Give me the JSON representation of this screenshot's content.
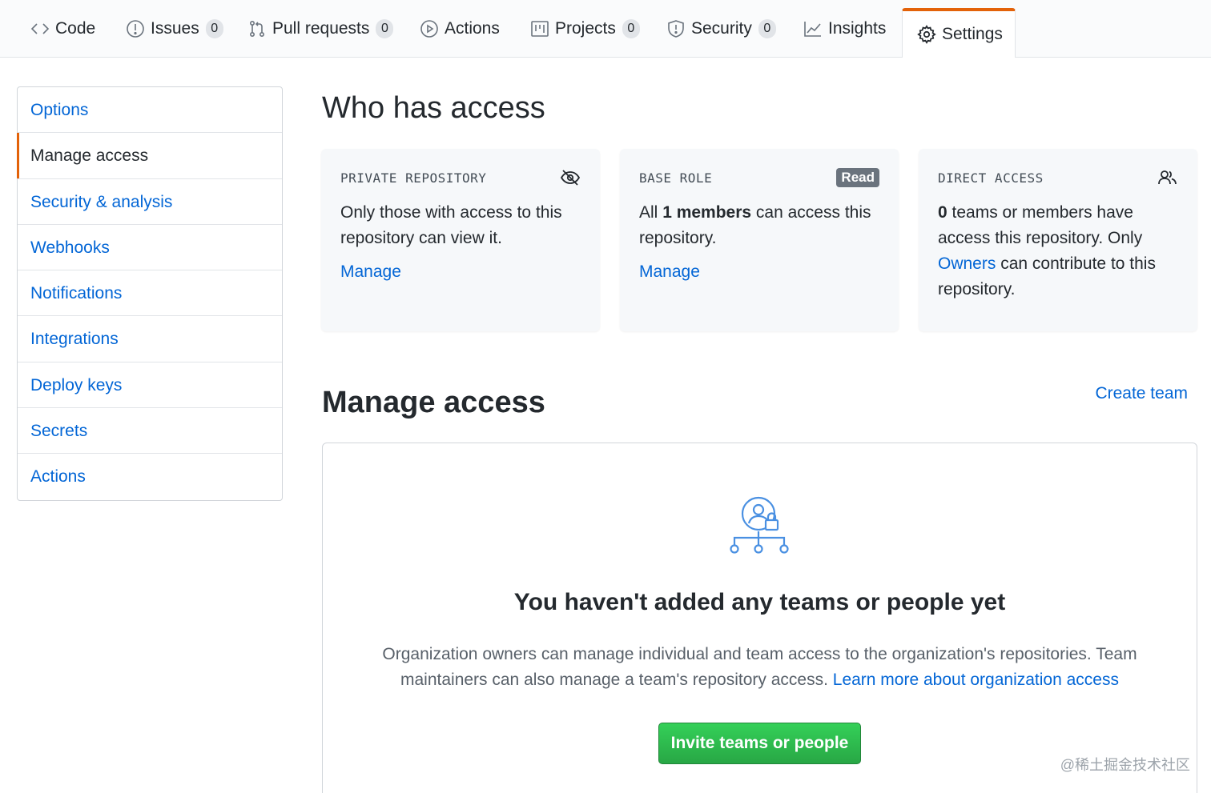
{
  "tabs": [
    {
      "label": "Code",
      "icon": "code-icon",
      "count": null
    },
    {
      "label": "Issues",
      "icon": "issue-icon",
      "count": "0"
    },
    {
      "label": "Pull requests",
      "icon": "pull-request-icon",
      "count": "0"
    },
    {
      "label": "Actions",
      "icon": "play-icon",
      "count": null
    },
    {
      "label": "Projects",
      "icon": "project-icon",
      "count": "0"
    },
    {
      "label": "Security",
      "icon": "shield-icon",
      "count": "0"
    },
    {
      "label": "Insights",
      "icon": "graph-icon",
      "count": null
    },
    {
      "label": "Settings",
      "icon": "gear-icon",
      "count": null,
      "selected": true
    }
  ],
  "sidebar": {
    "items": [
      {
        "label": "Options"
      },
      {
        "label": "Manage access",
        "active": true
      },
      {
        "label": "Security & analysis"
      },
      {
        "label": "Webhooks"
      },
      {
        "label": "Notifications"
      },
      {
        "label": "Integrations"
      },
      {
        "label": "Deploy keys"
      },
      {
        "label": "Secrets"
      },
      {
        "label": "Actions"
      }
    ]
  },
  "who_has_access": {
    "title": "Who has access",
    "cards": {
      "private": {
        "label": "PRIVATE REPOSITORY",
        "icon": "eye-closed-icon",
        "text": "Only those with access to this repository can view it.",
        "link": "Manage"
      },
      "base_role": {
        "label": "BASE ROLE",
        "badge": "Read",
        "text_prefix": "All ",
        "text_bold": "1 members",
        "text_suffix": " can access this repository.",
        "link": "Manage"
      },
      "direct": {
        "label": "DIRECT ACCESS",
        "icon": "people-icon",
        "text_bold": "0",
        "text_1": " teams or members have access this repository. Only ",
        "text_link": "Owners",
        "text_2": " can contribute to this repository."
      }
    }
  },
  "manage_access": {
    "title": "Manage access",
    "create_team": "Create team",
    "blank_state": {
      "illustration": "team-lock-icon",
      "heading": "You haven't added any teams or people yet",
      "description": "Organization owners can manage individual and team access to the organization's repositories. Team maintainers can also manage a team's repository access. ",
      "learn_more": "Learn more about organization access",
      "invite_button": "Invite teams or people"
    }
  },
  "watermark": "@稀土掘金技术社区",
  "colors": {
    "accent": "#e36209",
    "link": "#0366d6",
    "primary_button": "#2ea44f",
    "badge": "#6a737d"
  }
}
